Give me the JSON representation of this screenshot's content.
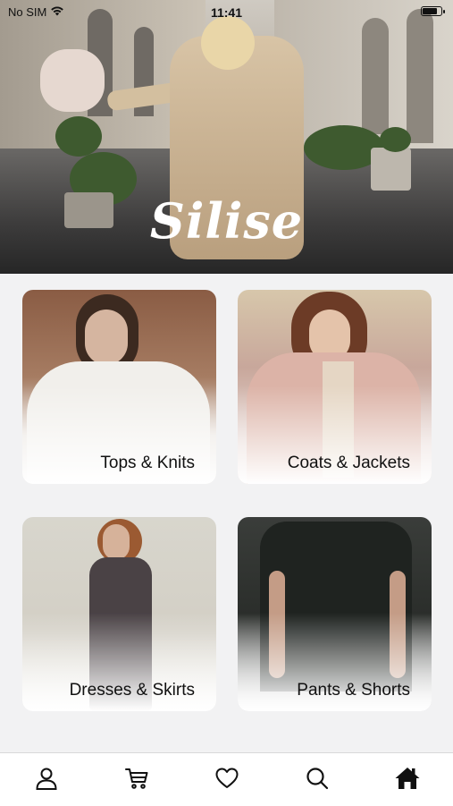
{
  "status_bar": {
    "carrier": "No SIM",
    "time": "11:41",
    "battery_level": 0.85
  },
  "hero": {
    "brand": "Silise"
  },
  "categories": [
    {
      "label": "Tops & Knits"
    },
    {
      "label": "Coats & Jackets"
    },
    {
      "label": "Dresses & Skirts"
    },
    {
      "label": "Pants & Shorts"
    }
  ],
  "tab_bar": {
    "items": [
      {
        "icon": "user-icon"
      },
      {
        "icon": "cart-icon"
      },
      {
        "icon": "heart-icon"
      },
      {
        "icon": "search-icon"
      },
      {
        "icon": "home-icon",
        "active": true
      }
    ]
  },
  "colors": {
    "background": "#f2f2f3",
    "tab_bar": "#ffffff",
    "icon": "#111111"
  }
}
